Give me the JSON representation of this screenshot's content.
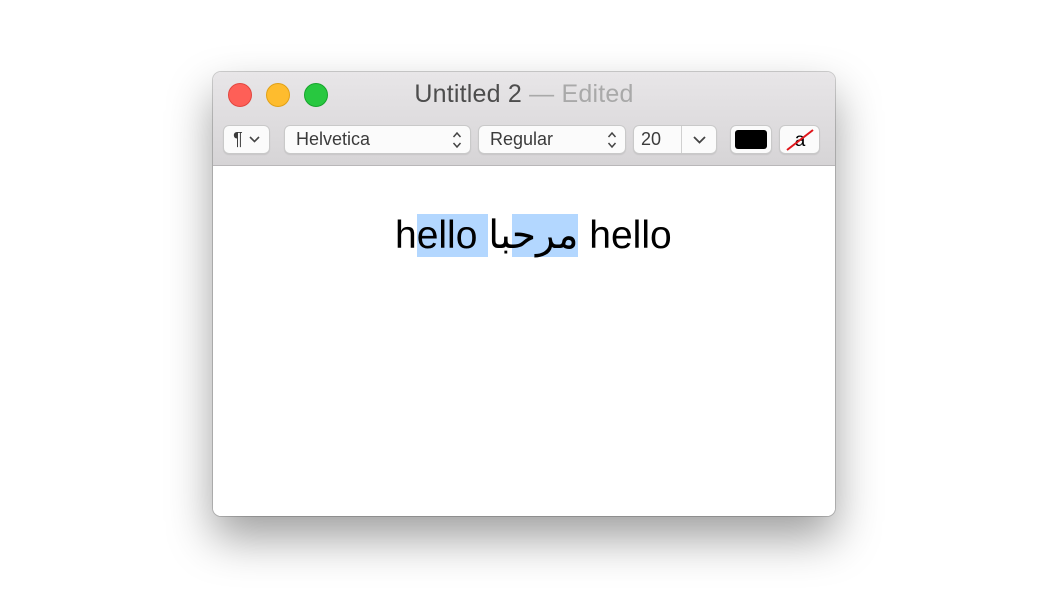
{
  "window": {
    "title": "Untitled 2",
    "title_separator": " — ",
    "status": "Edited"
  },
  "toolbar": {
    "paragraph_glyph": "¶",
    "font_family": "Helvetica",
    "font_style": "Regular",
    "font_size": "20",
    "text_color": "#000000",
    "background_color_glyph": "a"
  },
  "document": {
    "before_selection": "h",
    "selected_text": "ello مرح",
    "after_selection_rtl": "با",
    "trailing_text": " hello",
    "selection_color": "#b3d7ff"
  }
}
